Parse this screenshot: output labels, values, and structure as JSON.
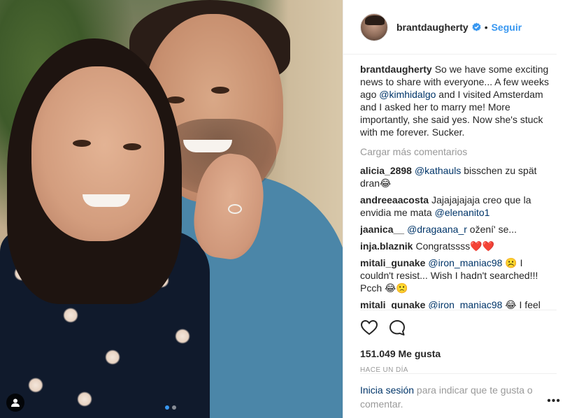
{
  "post": {
    "username": "brantdaugherty",
    "follow_label": "Seguir",
    "separator": "•",
    "caption": {
      "author": "brantdaugherty",
      "text_before": "So we have some exciting news to share with everyone... A few weeks ago ",
      "mention": "@kimhidalgo",
      "text_after": " and I visited Amsterdam and I asked her to marry me! More importantly, she said yes. Now she's stuck with me forever. Sucker."
    },
    "load_more_label": "Cargar más comentarios",
    "comments": [
      {
        "author": "alicia_2898",
        "mention": "@kathauls",
        "text": " bisschen zu spät dran😂"
      },
      {
        "author": "andreeaacosta",
        "mention": "",
        "text": "Jajajajajaja creo que la envidia me mata ",
        "mention_end": "@elenanito1"
      },
      {
        "author": "jaanica__",
        "mention": "@dragaana_r",
        "text": " ožení' se..."
      },
      {
        "author": "inja.blaznik",
        "mention": "",
        "text": "Congratssss❤️❤️"
      },
      {
        "author": "mitali_gunake",
        "mention": "@iron_maniac98",
        "text": " ☹️ I couldn't resist... Wish I hadn't searched!!! Pcch 😂🙁"
      },
      {
        "author": "mitali_gunake",
        "mention": "@iron_maniac98",
        "text": " 😂 I feel"
      }
    ],
    "likes": "151.049 Me gusta",
    "timestamp": "HACE UN DÍA",
    "login_link": "Inicia sesión",
    "login_text": " para indicar que te gusta o comentar.",
    "more_label": "•••",
    "icons": {
      "verified": "verified-badge-icon",
      "like": "heart-icon",
      "comment": "comment-bubble-icon",
      "user_tag": "user-tag-icon",
      "more": "more-options-icon"
    },
    "colors": {
      "link_blue": "#3897f0",
      "mention_blue": "#003569",
      "muted_gray": "#999999",
      "text": "#262626"
    }
  }
}
